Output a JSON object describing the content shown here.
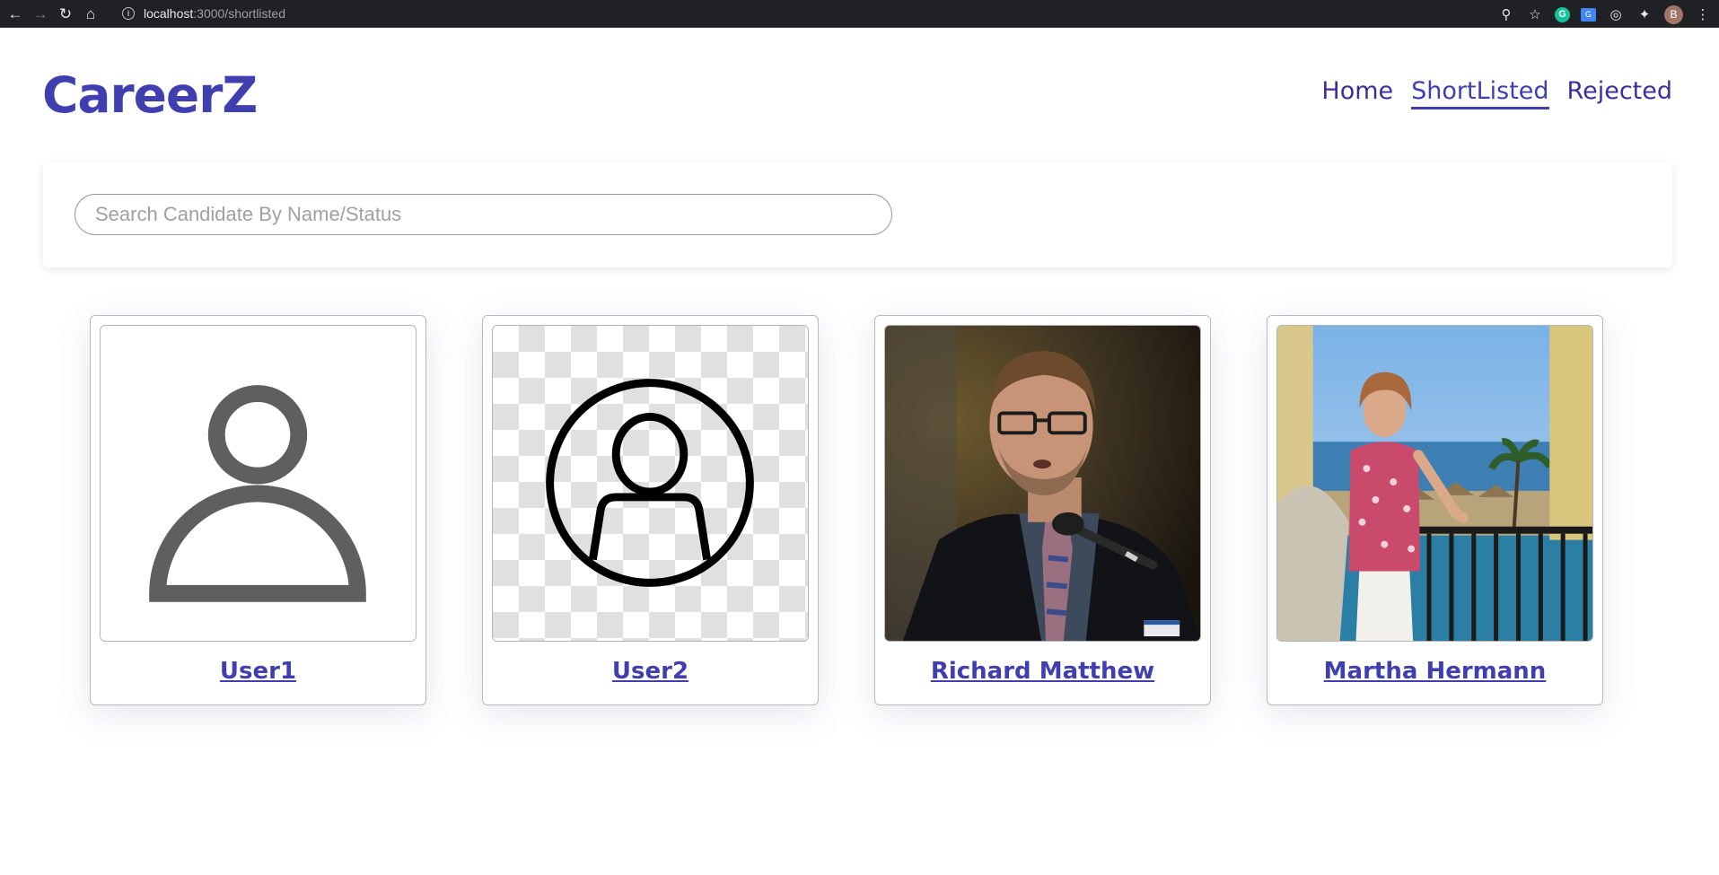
{
  "browser": {
    "url_host": "localhost",
    "url_path": ":3000/shortlisted",
    "profile_initial": "B",
    "extension_g_label": "G",
    "extension_t_label": "G"
  },
  "app": {
    "brand": "CareerZ",
    "nav": [
      {
        "label": "Home",
        "active": false
      },
      {
        "label": "ShortListed",
        "active": true
      },
      {
        "label": "Rejected",
        "active": false
      }
    ]
  },
  "search": {
    "placeholder": "Search Candidate By Name/Status",
    "value": ""
  },
  "candidates": [
    {
      "name": "User1",
      "photo": "default-avatar-icon"
    },
    {
      "name": "User2",
      "photo": "circle-avatar-icon"
    },
    {
      "name": "Richard Matthew",
      "photo": "man-at-microphone-photo"
    },
    {
      "name": "Martha Hermann",
      "photo": "woman-on-balcony-photo"
    }
  ],
  "colors": {
    "brand": "#3f3fb0",
    "nav_text": "#3d2e9a",
    "chrome_bg": "#202124"
  }
}
